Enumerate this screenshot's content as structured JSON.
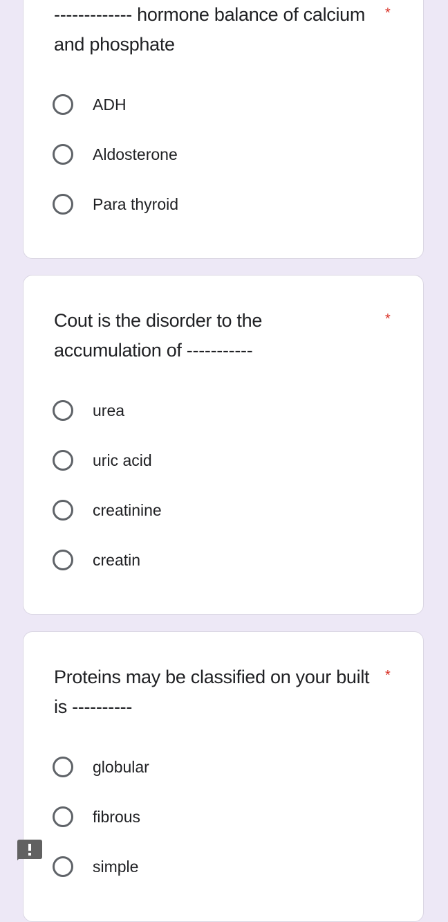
{
  "questions": [
    {
      "title": "------------- hormone balance of calcium and phosphate",
      "required": "*",
      "options": [
        "ADH",
        "Aldosterone",
        "Para thyroid"
      ]
    },
    {
      "title": "Cout is the disorder to the accumulation of -----------",
      "required": "*",
      "options": [
        "urea",
        "uric acid",
        "creatinine",
        "creatin"
      ]
    },
    {
      "title": "Proteins may be classified on your built is ----------",
      "required": "*",
      "options": [
        "globular",
        "fibrous",
        "simple"
      ]
    }
  ],
  "report_icon": "report-issue-icon"
}
